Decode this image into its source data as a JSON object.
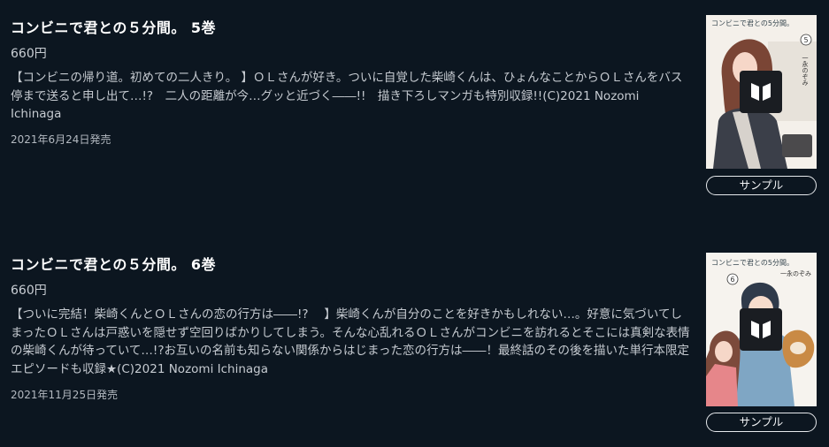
{
  "items": [
    {
      "title": "コンビニで君との５分間。 5巻",
      "price": "660円",
      "description": "【コンビニの帰り道。初めての二人きり。 】ＯＬさんが好き。ついに自覚した柴崎くんは、ひょんなことからＯＬさんをバス停まで送ると申し出て…!?　二人の距離が今…グッと近づく――!!　描き下ろしマンガも特別収録!!(C)2021 Nozomi Ichinaga",
      "release_date": "2021年6月24日発売",
      "sample_label": "サンプル",
      "cover_icon": "book-open-icon",
      "cover_title_text": "コンビニで君との5分間。",
      "cover_author_text": "一永のぞみ",
      "cover_volume": "5"
    },
    {
      "title": "コンビニで君との５分間。 6巻",
      "price": "660円",
      "description": "【ついに完結！柴崎くんとＯＬさんの恋の行方は――!?　 】柴崎くんが自分のことを好きかもしれない…。好意に気づいてしまったＯＬさんは戸惑いを隠せず空回りばかりしてしまう。そんな心乱れるＯＬさんがコンビニを訪れるとそこには真剣な表情の柴崎くんが待っていて…!?お互いの名前も知らない関係からはじまった恋の行方は――！最終話のその後を描いた単行本限定エピソードも収録★(C)2021 Nozomi Ichinaga",
      "release_date": "2021年11月25日発売",
      "sample_label": "サンプル",
      "cover_icon": "book-open-icon",
      "cover_title_text": "コンビニで君との5分間。",
      "cover_author_text": "一永のぞみ",
      "cover_volume": "6"
    }
  ],
  "colors": {
    "background": "#0c1620",
    "title": "#ffffff",
    "text": "#c5cad0",
    "button_border": "#e6e9ec",
    "badge": "#1a1d22",
    "cover_title_accent": "#3f8fd6"
  }
}
